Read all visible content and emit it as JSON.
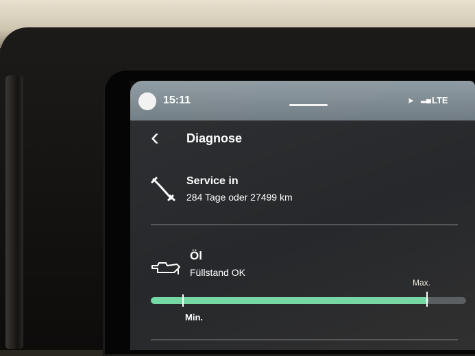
{
  "status": {
    "time": "15:11",
    "network": "LTE"
  },
  "header": {
    "title": "Diagnose"
  },
  "service": {
    "title": "Service in",
    "detail": "284 Tage oder 27499 km"
  },
  "oil": {
    "title": "Öl",
    "status": "Füllstand OK",
    "level_fraction": 0.88,
    "min_label": "Min.",
    "max_label": "Max."
  },
  "colors": {
    "accent": "#74d7a4",
    "screen": "#26282b",
    "text": "#ffffff"
  },
  "icons": [
    "user-avatar-icon",
    "navigation-arrow-icon",
    "signal-icon",
    "back-chevron-icon",
    "wrench-icon",
    "oil-can-icon"
  ]
}
